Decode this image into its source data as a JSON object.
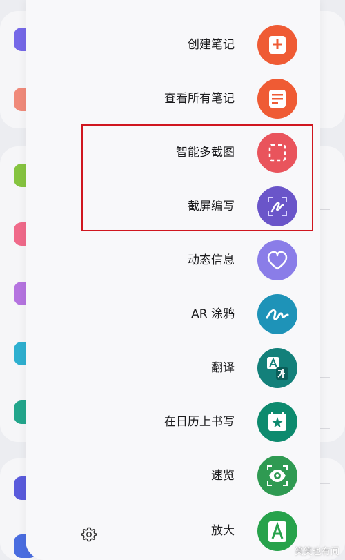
{
  "menu": {
    "items": [
      {
        "label": "创建笔记",
        "icon": "note-add-icon",
        "color": "#ef5b34"
      },
      {
        "label": "查看所有笔记",
        "icon": "notes-list-icon",
        "color": "#ef5b34"
      },
      {
        "label": "智能多截图",
        "icon": "smart-select-icon",
        "color": "#e9545c"
      },
      {
        "label": "截屏编写",
        "icon": "screen-write-icon",
        "color": "#6a55c9"
      },
      {
        "label": "动态信息",
        "icon": "live-message-icon",
        "color": "#8a7de8"
      },
      {
        "label": "AR 涂鸦",
        "icon": "ar-doodle-icon",
        "color": "#1e93b8"
      },
      {
        "label": "翻译",
        "icon": "translate-icon",
        "color": "#13807a"
      },
      {
        "label": "在日历上书写",
        "icon": "write-on-calendar-icon",
        "color": "#0d8a6e"
      },
      {
        "label": "速览",
        "icon": "glance-icon",
        "color": "#2f9a52"
      },
      {
        "label": "放大",
        "icon": "magnify-icon",
        "color": "#27a24b"
      }
    ],
    "settings_icon": "gear-icon"
  },
  "annotation": {
    "color": "#d0161f"
  },
  "watermark": "笑笑也有闻"
}
